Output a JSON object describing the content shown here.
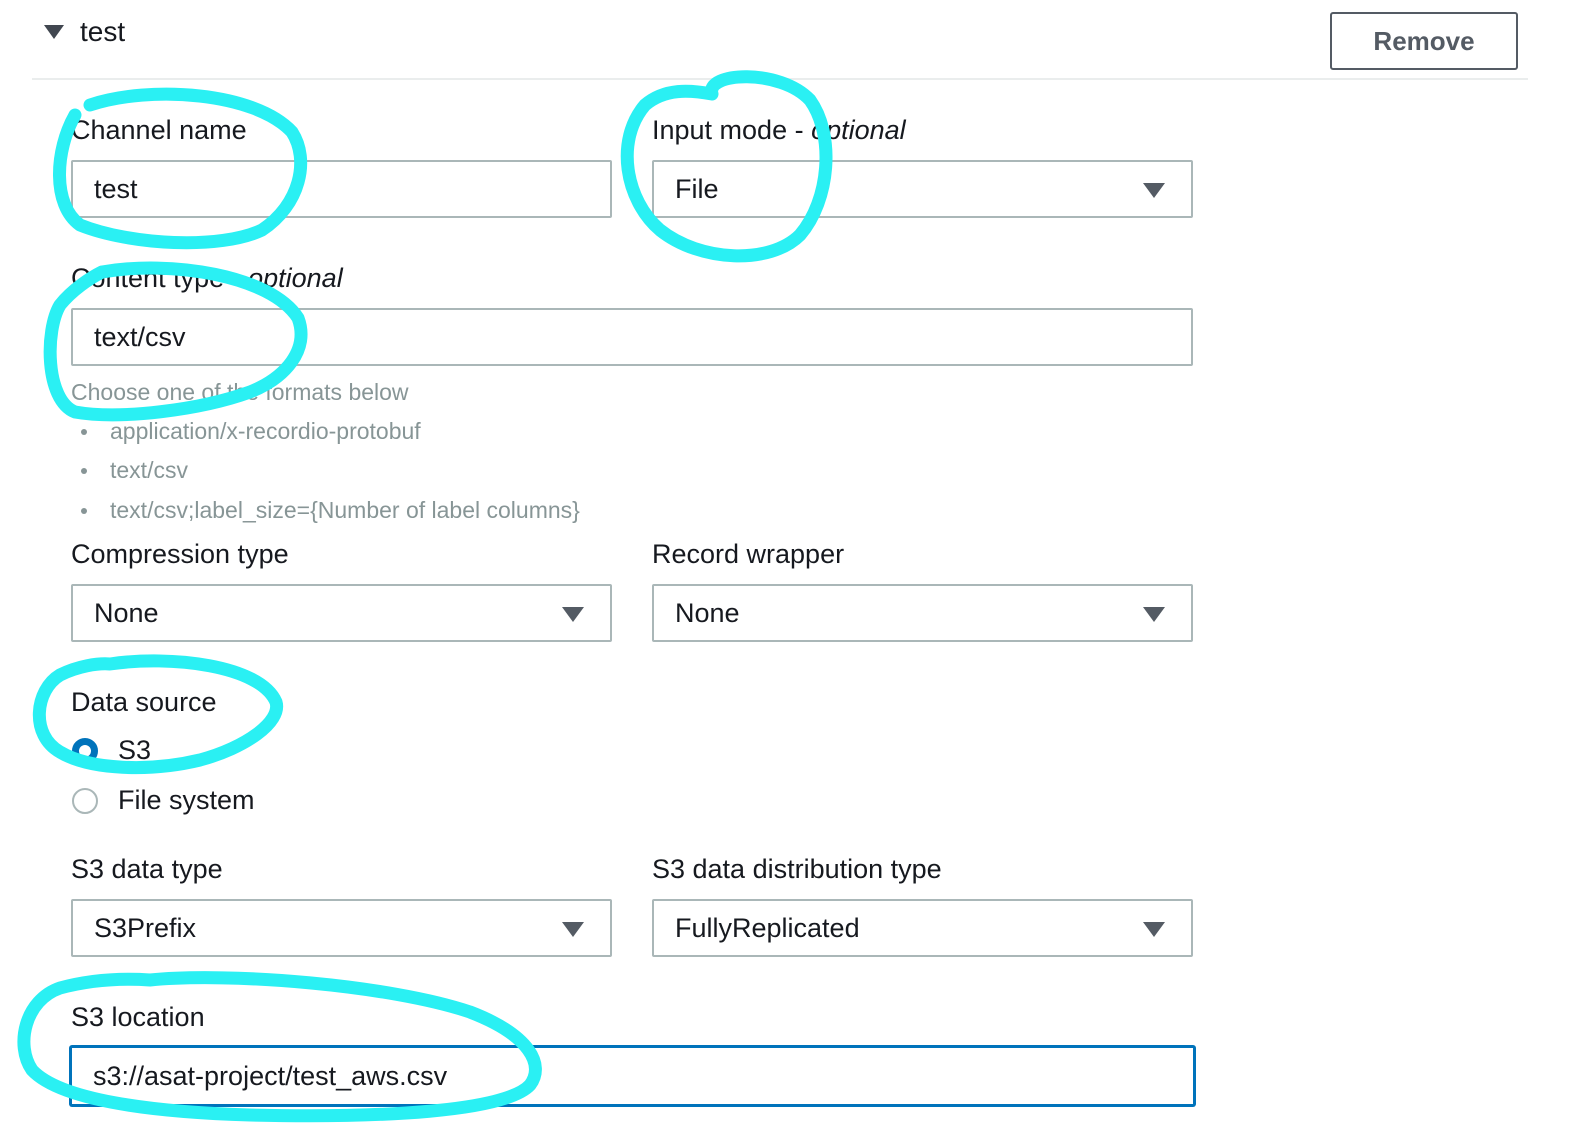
{
  "header": {
    "section_title": "test",
    "remove_label": "Remove"
  },
  "channel_name": {
    "label": "Channel name",
    "value": "test"
  },
  "input_mode": {
    "label": "Input mode - ",
    "optional": "optional",
    "value": "File"
  },
  "content_type": {
    "label": "Content type - ",
    "optional": "optional",
    "value": "text/csv",
    "help": "Choose one of the formats below",
    "formats": [
      "application/x-recordio-protobuf",
      "text/csv",
      "text/csv;label_size={Number of label columns}"
    ]
  },
  "compression_type": {
    "label": "Compression type",
    "value": "None"
  },
  "record_wrapper": {
    "label": "Record wrapper",
    "value": "None"
  },
  "data_source": {
    "label": "Data source",
    "options": [
      {
        "label": "S3",
        "checked": true
      },
      {
        "label": "File system",
        "checked": false
      }
    ]
  },
  "s3_data_type": {
    "label": "S3 data type",
    "value": "S3Prefix"
  },
  "s3_distribution_type": {
    "label": "S3 data distribution type",
    "value": "FullyReplicated"
  },
  "s3_location": {
    "label": "S3 location",
    "value": "s3://asat-project/test_aws.csv"
  },
  "colors": {
    "annotation": "#2af0f3",
    "focus": "#0073bb",
    "border": "#aab7b8",
    "help_text": "#879596"
  },
  "icons": {
    "collapse": "caret-down-icon",
    "select": "chevron-down-icon",
    "list_bullet": "bullet-icon"
  }
}
